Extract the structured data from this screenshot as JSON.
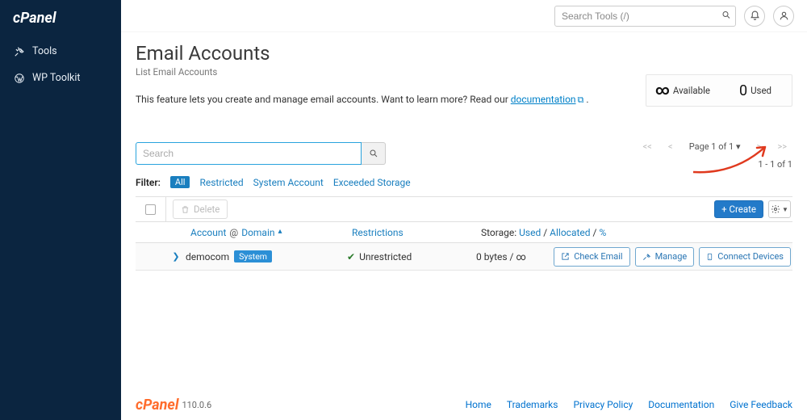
{
  "brand": "cPanel",
  "sidebar": {
    "items": [
      {
        "label": "Tools",
        "icon": "tools"
      },
      {
        "label": "WP Toolkit",
        "icon": "wp"
      }
    ]
  },
  "topbar": {
    "search_placeholder": "Search Tools (/)"
  },
  "page": {
    "title": "Email Accounts",
    "subtitle": "List Email Accounts",
    "intro_prefix": "This feature lets you create and manage email accounts. Want to learn more? Read our ",
    "intro_link": "documentation",
    "intro_suffix": " ."
  },
  "stats": {
    "available_label": "Available",
    "available_value": "∞",
    "used_label": "Used",
    "used_value": "0"
  },
  "search": {
    "placeholder": "Search"
  },
  "pager": {
    "first": "<<",
    "prev": "<",
    "label": "Page 1 of 1 ▾",
    "next": ">",
    "last": ">>",
    "range": "1 - 1 of 1"
  },
  "filters": {
    "label": "Filter:",
    "all": "All",
    "restricted": "Restricted",
    "system": "System Account",
    "exceeded": "Exceeded Storage"
  },
  "actions": {
    "delete": "Delete",
    "create": "+ Create"
  },
  "table": {
    "header": {
      "account": "Account",
      "at": "@",
      "domain": "Domain",
      "restrictions": "Restrictions",
      "storage": "Storage:",
      "used": "Used",
      "sep": "/",
      "allocated": "Allocated",
      "percent": "%"
    },
    "rows": [
      {
        "account": "democom",
        "badge": "System",
        "restriction": "Unrestricted",
        "storage": "0 bytes / ∞",
        "btn_check": "Check Email",
        "btn_manage": "Manage",
        "btn_connect": "Connect Devices"
      }
    ]
  },
  "footer": {
    "version": "110.0.6",
    "links": {
      "home": "Home",
      "trademarks": "Trademarks",
      "privacy": "Privacy Policy",
      "docs": "Documentation",
      "feedback": "Give Feedback"
    }
  }
}
